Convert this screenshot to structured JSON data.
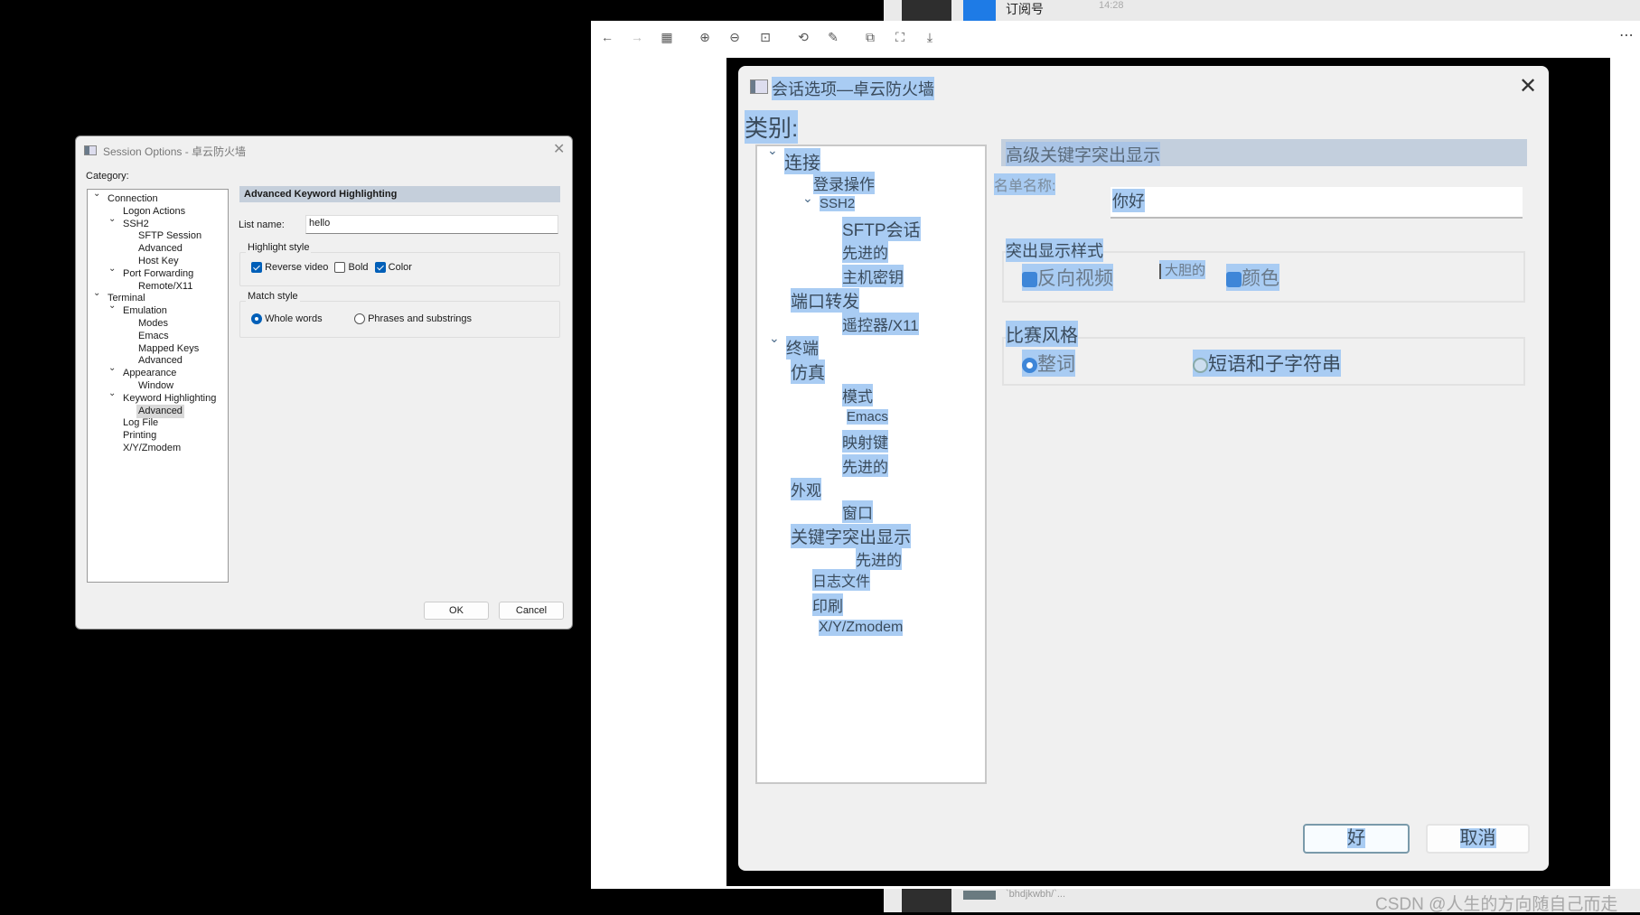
{
  "left_dialog": {
    "title": "Session Options - 卓云防火墙",
    "category_label": "Category:",
    "tree": [
      {
        "label": "Connection",
        "level": 0,
        "expanded": true
      },
      {
        "label": "Logon Actions",
        "level": 1
      },
      {
        "label": "SSH2",
        "level": 1,
        "expanded": true
      },
      {
        "label": "SFTP Session",
        "level": 2
      },
      {
        "label": "Advanced",
        "level": 2
      },
      {
        "label": "Host Key",
        "level": 2
      },
      {
        "label": "Port Forwarding",
        "level": 1,
        "expanded": true
      },
      {
        "label": "Remote/X11",
        "level": 2
      },
      {
        "label": "Terminal",
        "level": 0,
        "expanded": true
      },
      {
        "label": "Emulation",
        "level": 1,
        "expanded": true
      },
      {
        "label": "Modes",
        "level": 2
      },
      {
        "label": "Emacs",
        "level": 2
      },
      {
        "label": "Mapped Keys",
        "level": 2
      },
      {
        "label": "Advanced",
        "level": 2
      },
      {
        "label": "Appearance",
        "level": 1,
        "expanded": true
      },
      {
        "label": "Window",
        "level": 2
      },
      {
        "label": "Keyword Highlighting",
        "level": 1,
        "expanded": true
      },
      {
        "label": "Advanced",
        "level": 2,
        "selected": true
      },
      {
        "label": "Log File",
        "level": 1
      },
      {
        "label": "Printing",
        "level": 1
      },
      {
        "label": "X/Y/Zmodem",
        "level": 1
      }
    ],
    "panel_header": "Advanced Keyword Highlighting",
    "list_name_label": "List name:",
    "list_name_value": "hello",
    "highlight_style_label": "Highlight style",
    "checkboxes": [
      {
        "label": "Reverse video",
        "checked": true
      },
      {
        "label": "Bold",
        "checked": false
      },
      {
        "label": "Color",
        "checked": true
      }
    ],
    "match_style_label": "Match style",
    "radios": [
      {
        "label": "Whole words",
        "selected": true
      },
      {
        "label": "Phrases and substrings",
        "selected": false
      }
    ],
    "ok_label": "OK",
    "cancel_label": "Cancel"
  },
  "viewer": {
    "toolbar_icons": [
      "back-arrow-icon",
      "forward-arrow-icon",
      "grid-icon",
      "zoom-in-icon",
      "zoom-out-icon",
      "fit-icon",
      "rotate-icon",
      "edit-icon",
      "translate-icon",
      "ocr-icon",
      "download-icon"
    ],
    "more_label": "⋯",
    "photo_dialog": {
      "title": "会话选项—卓云防火墙",
      "category_label": "类别:",
      "tree": [
        "连接",
        "登录操作",
        "SSH2",
        "SFTP会话",
        "先进的",
        "主机密钥",
        "端口转发",
        "遥控器/X11",
        "终端",
        "仿真",
        "模式",
        "Emacs",
        "映射键",
        "先进的",
        "外观",
        "窗口",
        "关键字突出显示",
        "先进的",
        "日志文件",
        "印刷",
        "X/Y/Zmodem"
      ],
      "panel_header": "高级关键字突出显示",
      "list_name_label": "名单名称:",
      "list_name_value": "你好",
      "highlight_style_label": "突出显示样式",
      "checkboxes": [
        {
          "label": "反向视频",
          "checked": true
        },
        {
          "label": "大胆的",
          "checked": false
        },
        {
          "label": "颜色",
          "checked": true
        }
      ],
      "match_style_label": "比赛风格",
      "radios": [
        {
          "label": "整词",
          "selected": true
        },
        {
          "label": "短语和子字符串",
          "selected": false
        }
      ],
      "ok_label": "好",
      "cancel_label": "取消"
    }
  },
  "chat_top": {
    "name": "订阅号",
    "time": "14:28"
  },
  "chat_bottom": {
    "name": "`bhdjkwbh/`..."
  },
  "watermark": "CSDN @人生的方向随自己而走",
  "colors": {
    "accent": "#005fb8",
    "selection": "#a9ccf3",
    "header": "#c5cfdb"
  }
}
